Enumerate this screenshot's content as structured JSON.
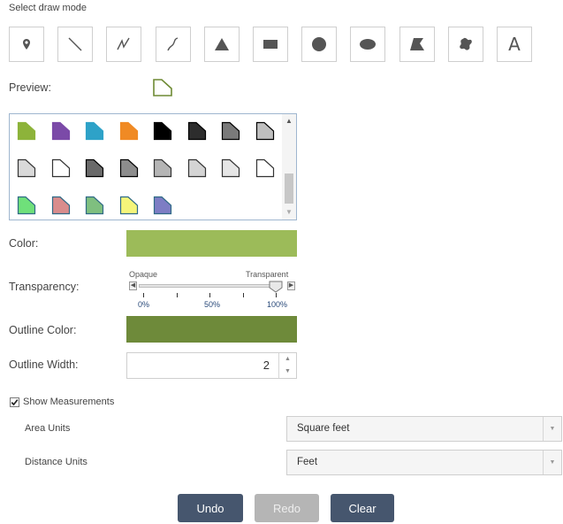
{
  "header": {
    "title": "Select draw mode"
  },
  "draw_modes": [
    {
      "name": "point",
      "icon": "map-pin-icon"
    },
    {
      "name": "line",
      "icon": "line-icon"
    },
    {
      "name": "polyline",
      "icon": "polyline-icon"
    },
    {
      "name": "freehand-polyline",
      "icon": "freehand-line-icon"
    },
    {
      "name": "triangle",
      "icon": "triangle-icon"
    },
    {
      "name": "rectangle",
      "icon": "rectangle-icon"
    },
    {
      "name": "circle",
      "icon": "circle-icon"
    },
    {
      "name": "ellipse",
      "icon": "ellipse-icon"
    },
    {
      "name": "polygon",
      "icon": "polygon-icon"
    },
    {
      "name": "freehand-polygon",
      "icon": "freehand-polygon-icon"
    },
    {
      "name": "text",
      "icon": "text-icon",
      "glyph": "A"
    }
  ],
  "preview": {
    "label": "Preview:",
    "fill": "#ffffff",
    "outline": "#6e8a33"
  },
  "symbols": [
    {
      "fill": "#8db33a",
      "outline": "#8db33a"
    },
    {
      "fill": "#7b4aa8",
      "outline": "#7b4aa8"
    },
    {
      "fill": "#2ea2c8",
      "outline": "#2ea2c8"
    },
    {
      "fill": "#f08a24",
      "outline": "#f08a24"
    },
    {
      "fill": "#000000",
      "outline": "#000000"
    },
    {
      "fill": "#2d2d2d",
      "outline": "#000000"
    },
    {
      "fill": "#7a7a7a",
      "outline": "#000000"
    },
    {
      "fill": "#bfbfbf",
      "outline": "#000000"
    },
    {
      "fill": "#d9d9d9",
      "outline": "#333333"
    },
    {
      "fill": "#ffffff",
      "outline": "#333333"
    },
    {
      "fill": "#6a6a6a",
      "outline": "#000000"
    },
    {
      "fill": "#8d8d8d",
      "outline": "#000000"
    },
    {
      "fill": "#b5b5b5",
      "outline": "#333333"
    },
    {
      "fill": "#d4d4d4",
      "outline": "#333333"
    },
    {
      "fill": "#e6e6e6",
      "outline": "#333333"
    },
    {
      "fill": "#ffffff",
      "outline": "#333333"
    },
    {
      "fill": "#6fe07a",
      "outline": "#2f6a86"
    },
    {
      "fill": "#d98c8c",
      "outline": "#2f6a86"
    },
    {
      "fill": "#7fbf7f",
      "outline": "#2f6a86"
    },
    {
      "fill": "#f5f57a",
      "outline": "#2f6a86"
    },
    {
      "fill": "#7d7dc4",
      "outline": "#2f6a86"
    }
  ],
  "color": {
    "label": "Color:",
    "value": "#9cbb59"
  },
  "transparency": {
    "label": "Transparency:",
    "min_label": "Opaque",
    "max_label": "Transparent",
    "ticks": [
      "0%",
      "50%",
      "100%"
    ],
    "value_percent": 100
  },
  "outline_color": {
    "label": "Outline Color:",
    "value": "#6e8a3a"
  },
  "outline_width": {
    "label": "Outline Width:",
    "value": "2"
  },
  "measurements": {
    "label": "Show Measurements",
    "checked": true,
    "area_units": {
      "label": "Area Units",
      "selected": "Square feet"
    },
    "distance_units": {
      "label": "Distance Units",
      "selected": "Feet"
    }
  },
  "actions": {
    "undo": "Undo",
    "redo": "Redo",
    "clear": "Clear",
    "primary_color": "#46566e",
    "disabled_color": "#b5b5b5"
  }
}
